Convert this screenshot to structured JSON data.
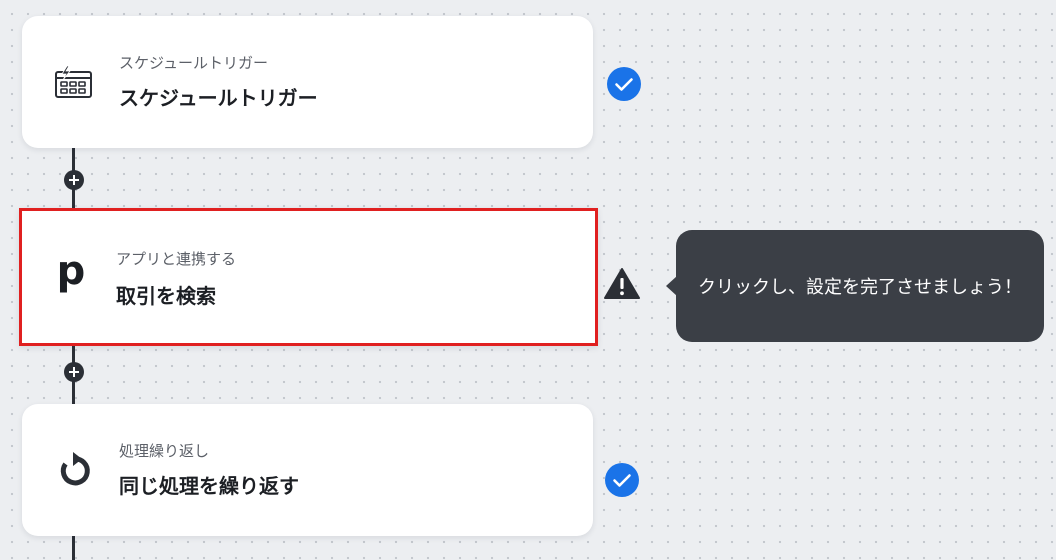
{
  "flow": {
    "steps": [
      {
        "icon": "schedule-trigger-icon",
        "subtitle": "スケジュールトリガー",
        "title": "スケジュールトリガー",
        "status": "complete"
      },
      {
        "icon": "freee-p-icon",
        "icon_letter": "p",
        "subtitle": "アプリと連携する",
        "title": "取引を検索",
        "status": "warning"
      },
      {
        "icon": "loop-icon",
        "subtitle": "処理繰り返し",
        "title": "同じ処理を繰り返す",
        "status": "complete"
      }
    ]
  },
  "tooltip": {
    "text": "クリックし、設定を完了させましょう！"
  },
  "colors": {
    "complete": "#1a73e8",
    "warning": "#2b2f36",
    "selected_border": "#e02020",
    "tooltip_bg": "#3b3f46"
  }
}
